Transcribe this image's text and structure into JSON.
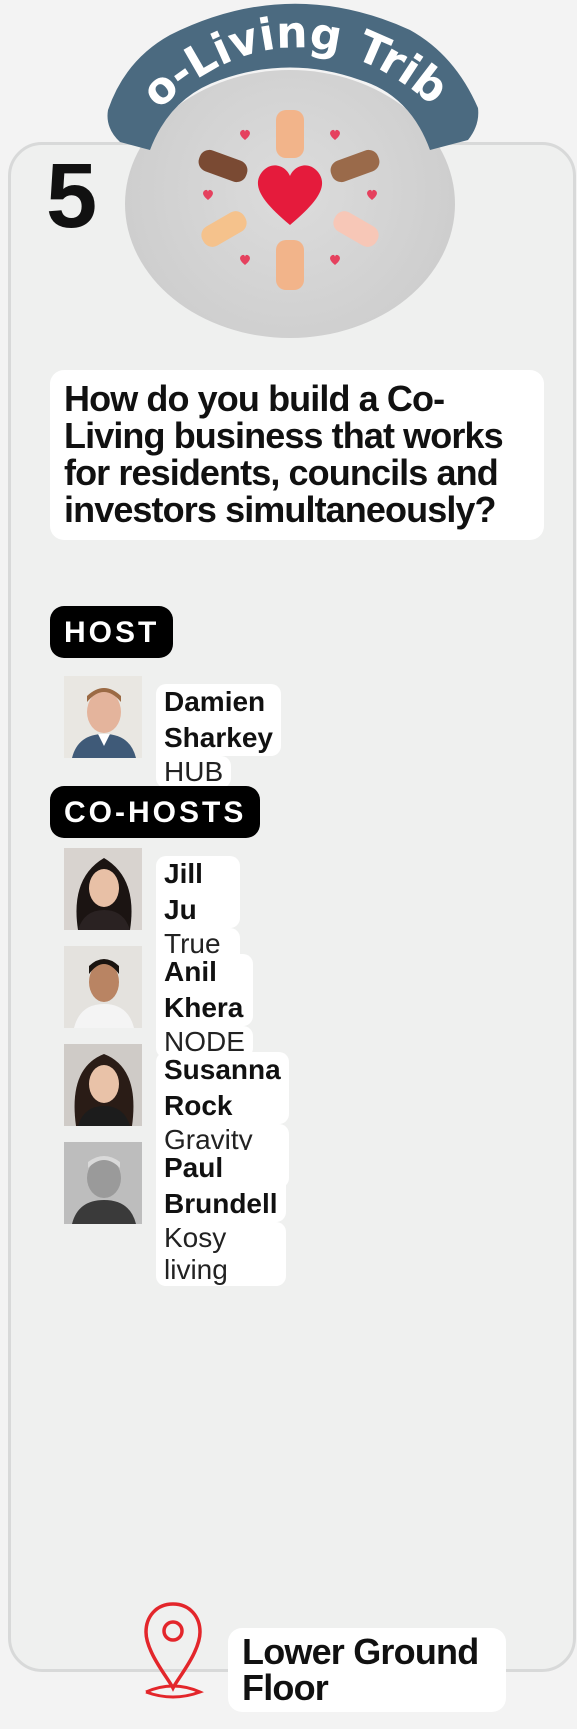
{
  "tribe": {
    "title": "Co-Living Tribe",
    "number": "5",
    "arc_color": "#4b6a80"
  },
  "question": "How do you build a Co-Living business that works for residents, councils and investors simultaneously?",
  "host_section": {
    "label": "HOST",
    "people": [
      {
        "name": "Damien Sharkey",
        "org": "HUB"
      }
    ]
  },
  "cohost_section": {
    "label": "CO-HOSTS",
    "people": [
      {
        "name": "Jill Ju",
        "org": "True North"
      },
      {
        "name": "Anil Khera",
        "org": "NODE"
      },
      {
        "name": "Susanna Rock",
        "org": "Gravity Co"
      },
      {
        "name": "Paul Brundell",
        "org": "Kosy living"
      }
    ]
  },
  "location": {
    "text": "Lower Ground Floor",
    "pin_icon": "map-pin-icon",
    "pin_color": "#e3262b"
  }
}
